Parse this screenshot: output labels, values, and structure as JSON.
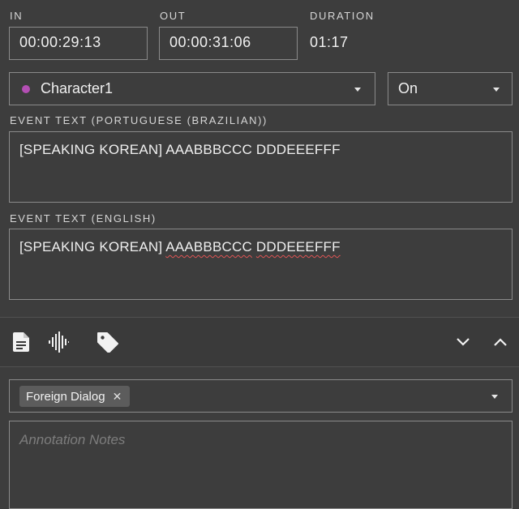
{
  "timing": {
    "in_label": "IN",
    "in_value": "00:00:29:13",
    "out_label": "OUT",
    "out_value": "00:00:31:06",
    "duration_label": "DURATION",
    "duration_value": "01:17"
  },
  "character": {
    "selected": "Character1",
    "dot_color": "#b44fb4"
  },
  "toggle": {
    "selected": "On"
  },
  "event_text_portuguese": {
    "label": "EVENT TEXT (PORTUGUESE (BRAZILIAN))",
    "value": "[SPEAKING KOREAN] AAABBBCCC DDDEEEFFF"
  },
  "event_text_english": {
    "label": "EVENT TEXT (ENGLISH)",
    "prefix": "[SPEAKING KOREAN]",
    "word1": "AAABBBCCC",
    "word2": "DDDEEEFFF"
  },
  "toolbar": {
    "icons": [
      "document-icon",
      "waveform-icon",
      "tag-icon",
      "chevron-down-icon",
      "chevron-up-icon"
    ]
  },
  "tags": {
    "chips": [
      "Foreign Dialog"
    ],
    "remove_glyph": "✕"
  },
  "annotation": {
    "placeholder": "Annotation Notes"
  },
  "colors": {
    "background": "#3d3d3d",
    "border": "#8a8a8a",
    "spellcheck": "#e05555"
  }
}
